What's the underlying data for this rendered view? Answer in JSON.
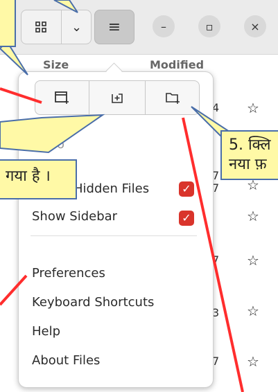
{
  "columns": {
    "size": "Size",
    "modified": "Modified"
  },
  "menu": {
    "items": [
      {
        "label": "Undo"
      },
      {
        "label": "Hidden Files"
      },
      {
        "label": "Show Sidebar"
      },
      {
        "label": "Preferences"
      },
      {
        "label": "Keyboard Shortcuts"
      },
      {
        "label": "Help"
      },
      {
        "label": "About Files"
      }
    ]
  },
  "annotations": {
    "callout_left": "गया है ।",
    "callout_right_line1": "5. क्लि",
    "callout_right_line2": "नया फ़"
  },
  "row_numbers": [
    "4",
    "7",
    "7",
    "7",
    "3",
    "7"
  ],
  "icons": {
    "grid_view": "grid-icon",
    "dropdown": "chevron-down-icon",
    "main_menu": "hamburger-icon",
    "minimize": "minimize-icon",
    "maximize": "maximize-icon",
    "close": "close-icon",
    "new_window": "new-window-icon",
    "new_tab": "new-tab-icon",
    "new_folder": "new-folder-icon",
    "favorite": "star-icon",
    "checked": "checkbox-checked-icon"
  },
  "colors": {
    "accent_checkbox": "#d9342b",
    "callout_fill": "#fff9a6",
    "callout_border": "#4a6ea9",
    "pointer_line": "#ff2d2d"
  }
}
